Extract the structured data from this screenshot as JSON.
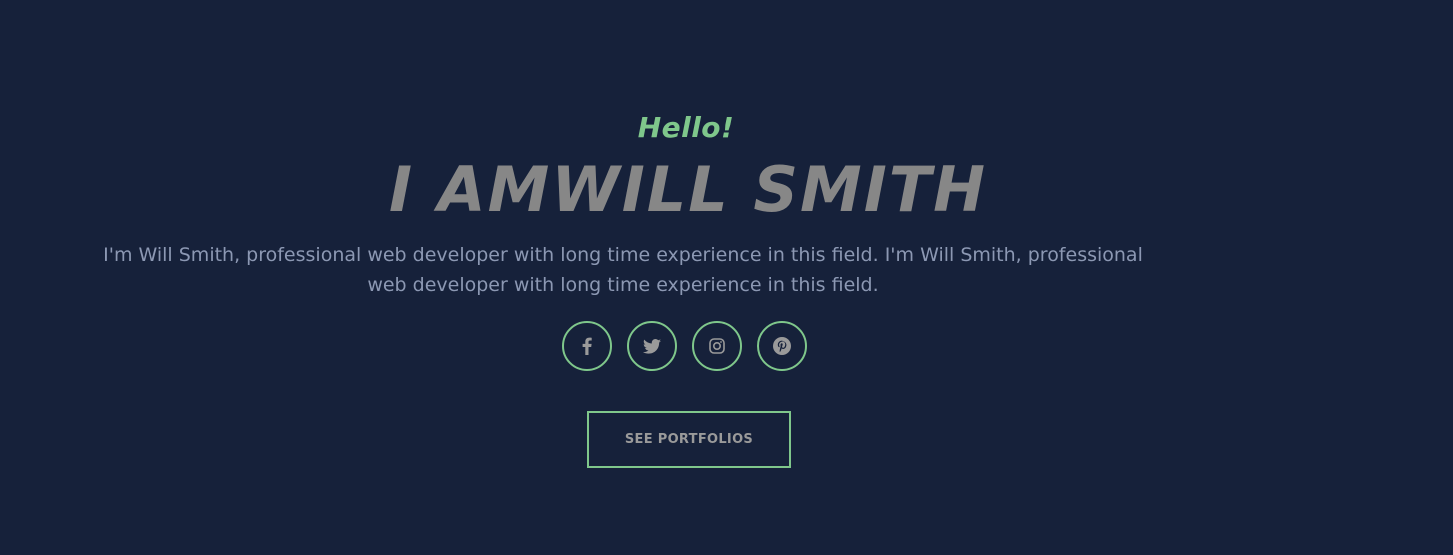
{
  "hero": {
    "greeting": "Hello!",
    "title": "I AMWILL SMITH",
    "bio": "I'm Will Smith, professional web developer with long time experience in this field. I'm Will Smith, professional web developer with long time experience in this field."
  },
  "socials": [
    {
      "icon": "facebook-icon"
    },
    {
      "icon": "twitter-icon"
    },
    {
      "icon": "instagram-icon"
    },
    {
      "icon": "pinterest-icon"
    }
  ],
  "cta": {
    "label": "SEE PORTFOLIOS"
  },
  "colors": {
    "background": "#16213a",
    "accent": "#7fc78b",
    "title": "#878787",
    "body_text": "#8c98b3",
    "icon": "#9a9a9a"
  }
}
